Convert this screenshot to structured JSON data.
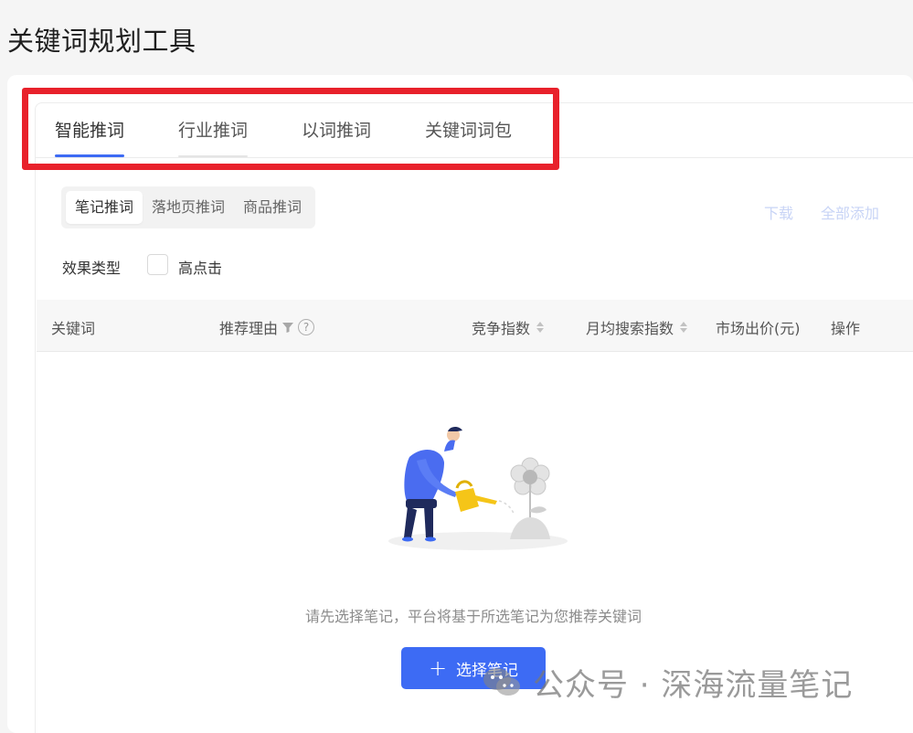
{
  "page": {
    "title": "关键词规划工具"
  },
  "tabs": [
    {
      "label": "智能推词",
      "active": true
    },
    {
      "label": "行业推词",
      "active": false
    },
    {
      "label": "以词推词",
      "active": false
    },
    {
      "label": "关键词词包",
      "active": false
    }
  ],
  "subtabs": [
    {
      "label": "笔记推词",
      "active": true
    },
    {
      "label": "落地页推词",
      "active": false
    },
    {
      "label": "商品推词",
      "active": false
    }
  ],
  "actions": {
    "download": "下载",
    "add_all": "全部添加"
  },
  "filter": {
    "label": "效果类型",
    "option": "高点击",
    "checked": false
  },
  "table": {
    "columns": {
      "keyword": "关键词",
      "reason": "推荐理由",
      "competition": "竞争指数",
      "monthly_search": "月均搜索指数",
      "market_bid": "市场出价(元)",
      "operation": "操作"
    }
  },
  "empty_state": {
    "message": "请先选择笔记，平台将基于所选笔记为您推荐关键词",
    "button_label": "选择笔记"
  },
  "watermark": {
    "text": "公众号 · 深海流量笔记"
  },
  "colors": {
    "accent": "#3d6bf4",
    "highlight": "#e8212b"
  }
}
